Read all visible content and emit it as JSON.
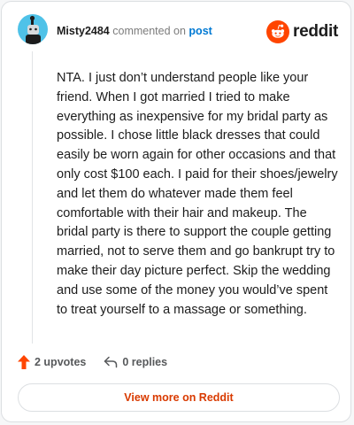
{
  "header": {
    "username": "Misty2484",
    "action_text": "commented on",
    "post_link": "post",
    "brand": "reddit"
  },
  "comment": {
    "body": "NTA. I just don’t understand people like your friend. When I got married I tried to make everything as inexpensive for my bridal party as possible. I chose little black dresses that could easily be worn again for other occasions and that only cost $100 each. I paid for their shoes/jewelry and let them do whatever made them feel comfortable with their hair and makeup. The bridal party is there to support the couple getting married, not to serve them and go bankrupt try to make their day picture perfect. Skip the wedding and use some of the money you would’ve spent to treat yourself to a massage or something."
  },
  "actions": {
    "upvotes": "2 upvotes",
    "replies": "0 replies"
  },
  "footer": {
    "view_more": "View more on Reddit"
  },
  "colors": {
    "upvote": "#ff4500",
    "link": "#0079d3",
    "view_more": "#d93a00",
    "avatar_bg": "#4fc2e8"
  },
  "icons": {
    "avatar": "snoo-avatar",
    "logo": "reddit-logo-icon",
    "upvote": "upvote-arrow-icon",
    "reply": "reply-arrow-icon"
  }
}
